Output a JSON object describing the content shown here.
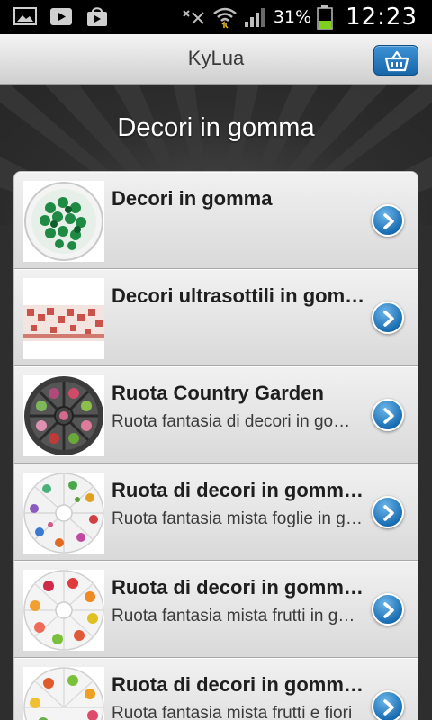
{
  "status_bar": {
    "battery_percent": "31%",
    "time": "12:23",
    "icons": [
      "gallery-icon",
      "youtube-icon",
      "shopping-bag-icon",
      "mute-icon",
      "wifi-icon",
      "signal-icon",
      "battery-icon"
    ]
  },
  "app_bar": {
    "title": "KyLua",
    "cart_icon": "basket-icon"
  },
  "hero": {
    "title": "Decori in gomma"
  },
  "items": [
    {
      "title": "Decori in gomma",
      "subtitle": ""
    },
    {
      "title": "Decori ultrasottili in gomma",
      "subtitle": ""
    },
    {
      "title": "Ruota Country Garden",
      "subtitle": "Ruota fantasia di decori in gomma"
    },
    {
      "title": "Ruota di decori in gomma mista",
      "subtitle": "Ruota fantasia mista foglie in gomma"
    },
    {
      "title": "Ruota di decori in gomma mista",
      "subtitle": "Ruota fantasia mista frutti in gomma"
    },
    {
      "title": "Ruota di decori in gomma mista",
      "subtitle": "Ruota fantasia mista frutti e fiori"
    }
  ],
  "colors": {
    "accent_blue": "#1766a8",
    "title_bar_top": "#f4f4f4",
    "hero_bg": "#2e2e2e"
  }
}
